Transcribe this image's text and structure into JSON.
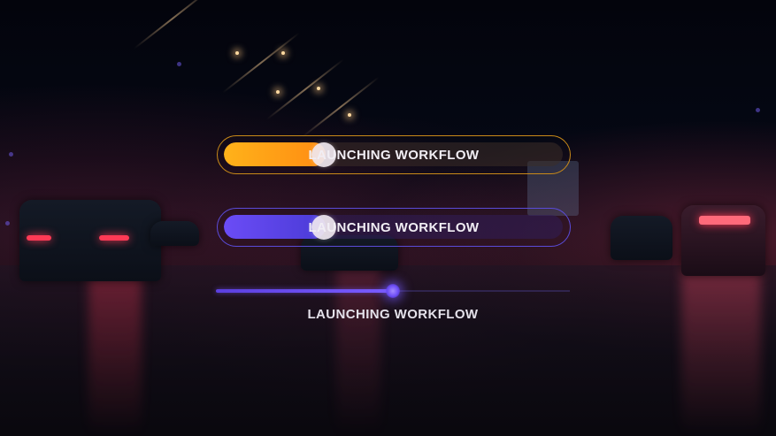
{
  "background": {
    "description_icon": "night-highway-icon",
    "colors": {
      "sky": "#05060f",
      "tail_light": "#ff3a55"
    }
  },
  "progress_orange": {
    "label": "LAUNCHING WORKFLOW",
    "value": 0.3,
    "color": "#ffa716"
  },
  "progress_purple": {
    "label": "LAUNCHING WORKFLOW",
    "value": 0.3,
    "color": "#6b4cf6"
  },
  "progress_thin": {
    "label": "LAUNCHING WORKFLOW",
    "value": 0.5,
    "color": "#7a5cff"
  }
}
